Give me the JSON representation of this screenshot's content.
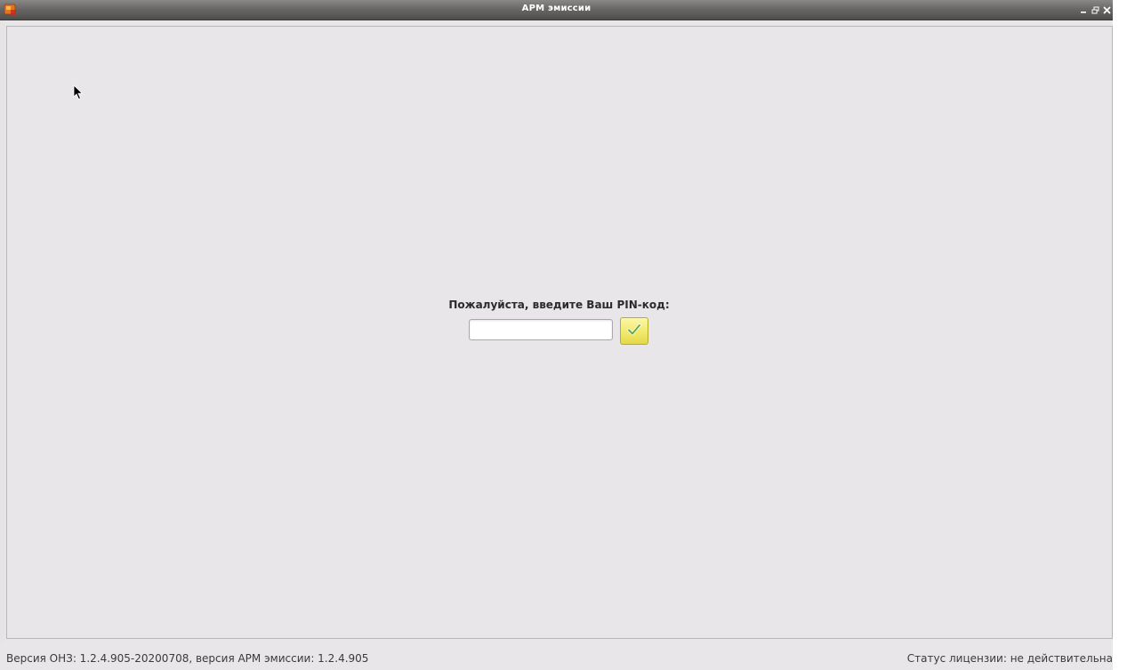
{
  "window": {
    "title": "АРМ эмиссии",
    "controls": {
      "minimize": "minimize-icon",
      "restore": "restore-icon",
      "close": "close-icon"
    },
    "app_icon": "app-icon"
  },
  "login": {
    "prompt": "Пожалуйста, введите Ваш PIN-код:",
    "pin_value": "",
    "submit_icon": "checkmark-icon"
  },
  "statusbar": {
    "version_text": "Версия ОНЗ: 1.2.4.905-20200708, версия АРМ эмиссии: 1.2.4.905",
    "license_text": "Статус лицензии: не действительна"
  },
  "colors": {
    "background": "#e9e6ea",
    "titlebar": "#5f5d5b",
    "submit_button": "#f1e96a",
    "checkmark": "#6aa84f"
  }
}
